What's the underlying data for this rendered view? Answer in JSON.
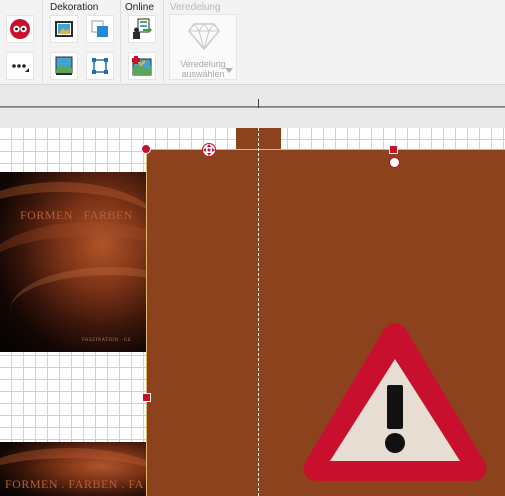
{
  "ribbon": {
    "groups": {
      "dekoration": "Dekoration",
      "online": "Online",
      "veredelung": "Veredelung"
    },
    "veredelung_button": {
      "line1": "Veredelung",
      "line2": "auswählen"
    }
  },
  "canvas": {
    "photo_title_top": "FORMEN . FARBEN",
    "photo_subtitle_top": "FASZINATION  ·  GE",
    "photo_title_bottom": "FORMEN . FARBEN . FA"
  },
  "colors": {
    "cover": "#8b421d",
    "handles": "#c8102e",
    "warning_red": "#c8102e",
    "warning_fill": "#e7ddd2"
  },
  "icons": {
    "eye": "eye-icon",
    "more": "more-options-icon",
    "frame": "picture-frame-icon",
    "layers": "bring-forward-icon",
    "image_bg": "image-background-icon",
    "crop": "crop-icon",
    "online_upload": "online-upload-icon",
    "online_map": "online-map-icon",
    "diamond": "diamond-icon",
    "warning": "warning-icon"
  }
}
